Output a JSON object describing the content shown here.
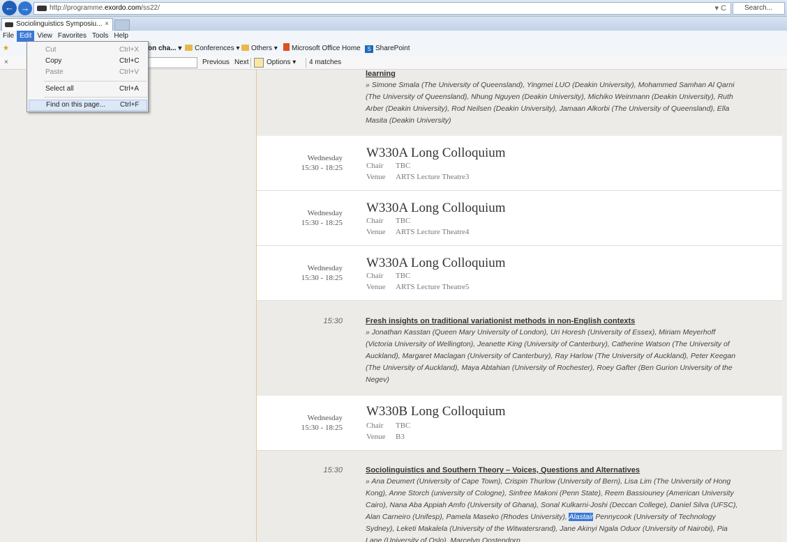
{
  "browser": {
    "url_prefix": "http://programme.",
    "url_domain": "exordo.com",
    "url_suffix": "/ss22/",
    "search_placeholder": "Search...",
    "tab_title": "Sociolinguistics Symposiu...",
    "refresh_label": "▾ C"
  },
  "menubar": [
    "File",
    "Edit",
    "View",
    "Favorites",
    "Tools",
    "Help"
  ],
  "favorites": {
    "item1": "on cha... ▾",
    "item2": "Conferences ▾",
    "item3": "Others ▾",
    "item4": "Microsoft Office Home",
    "item5": "SharePoint"
  },
  "findbar": {
    "close": "×",
    "previous": "Previous",
    "next": "Next",
    "options": "Options ▾",
    "matches": "4 matches"
  },
  "edit_menu": [
    {
      "label": "Cut",
      "shortcut": "Ctrl+X",
      "enabled": false
    },
    {
      "label": "Copy",
      "shortcut": "Ctrl+C",
      "enabled": true
    },
    {
      "label": "Paste",
      "shortcut": "Ctrl+V",
      "enabled": false
    },
    {
      "label": "Select all",
      "shortcut": "Ctrl+A",
      "enabled": true
    },
    {
      "label": "Find on this page...",
      "shortcut": "Ctrl+F",
      "enabled": true
    }
  ],
  "content": {
    "paper0": {
      "title": "learning",
      "authors": "» Simone Smala (The University of Queensland), Yingmei LUO (Deakin University), Mohammed Samhan Al Qarni (The University of Queensland), Nhung Nguyen (Deakin University), Michiko Weinmann (Deakin University), Ruth Arber (Deakin University), Rod Neilsen (Deakin University), Jamaan Alkorbi (The University of Queensland), Ella Masita (Deakin University)"
    },
    "session1": {
      "day": "Wednesday",
      "time": "15:30 - 18:25",
      "title": "W330A Long Colloquium",
      "chair_label": "Chair",
      "chair": "TBC",
      "venue_label": "Venue",
      "venue": "ARTS Lecture Theatre3"
    },
    "session2": {
      "day": "Wednesday",
      "time": "15:30 - 18:25",
      "title": "W330A Long Colloquium",
      "chair_label": "Chair",
      "chair": "TBC",
      "venue_label": "Venue",
      "venue": "ARTS Lecture Theatre4"
    },
    "session3": {
      "day": "Wednesday",
      "time": "15:30 - 18:25",
      "title": "W330A Long Colloquium",
      "chair_label": "Chair",
      "chair": "TBC",
      "venue_label": "Venue",
      "venue": "ARTS Lecture Theatre5"
    },
    "paper1": {
      "time": "15:30",
      "title": "Fresh insights on traditional variationist methods in non-English contexts",
      "authors": "» Jonathan Kasstan (Queen Mary University of London), Uri Horesh (University of Essex), Miriam Meyerhoff (Victoria University of Wellington), Jeanette King (University of Canterbury), Catherine Watson (The University of Auckland), Margaret Maclagan (University of Canterbury), Ray Harlow (The University of Auckland), Peter Keegan (The University of Auckland), Maya Abtahian (University of Rochester), Roey Gafter (Ben Gurion University of the Negev)"
    },
    "session4": {
      "day": "Wednesday",
      "time": "15:30 - 18:25",
      "title": "W330B Long Colloquium",
      "chair_label": "Chair",
      "chair": "TBC",
      "venue_label": "Venue",
      "venue": "B3"
    },
    "paper2": {
      "time": "15:30",
      "title": "Sociolinguistics and Southern Theory – Voices, Questions and Alternatives",
      "authors_a": "» Ana Deumert (University of Cape Town), Crispin Thurlow (University of Bern), Lisa Lim (The University of Hong Kong), Anne Storch (university of Cologne), Sinfree Makoni (Penn State), Reem Bassiouney (American University Cairo), Nana Aba Appiah Amfo (University of Ghana), Sonal Kulkarni-Joshi (Deccan College), Daniel Silva (UFSC), Alan Carneiro (Unifesp), Pamela Maseko (Rhodes University), ",
      "highlight": "Alastair",
      "authors_b": " Pennycook (University of Technology Sydney), Leketi Makalela (University of the Witwatersrand), Jane Akinyi Ngala Oduor (University of Nairobi), Pia Lane (University of Oslo), Marcelyn Oostendorp"
    }
  }
}
